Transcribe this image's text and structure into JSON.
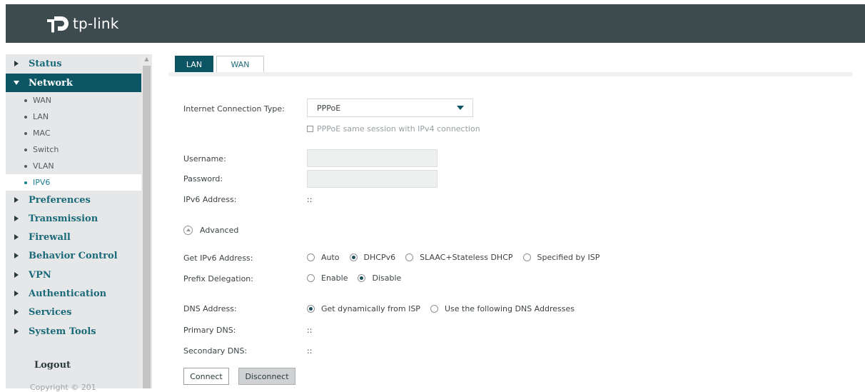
{
  "header": {
    "brand": "tp-link"
  },
  "sidebar": {
    "menu": [
      {
        "label": "Status"
      },
      {
        "label": "Network"
      },
      {
        "label": "Preferences"
      },
      {
        "label": "Transmission"
      },
      {
        "label": "Firewall"
      },
      {
        "label": "Behavior Control"
      },
      {
        "label": "VPN"
      },
      {
        "label": "Authentication"
      },
      {
        "label": "Services"
      },
      {
        "label": "System Tools"
      }
    ],
    "network_sub": [
      {
        "label": "WAN"
      },
      {
        "label": "LAN"
      },
      {
        "label": "MAC"
      },
      {
        "label": "Switch"
      },
      {
        "label": "VLAN"
      },
      {
        "label": "IPV6"
      }
    ],
    "logout": "Logout",
    "copyright": "Copyright © 201"
  },
  "tabs": {
    "lan": "LAN",
    "wan": "WAN"
  },
  "form": {
    "conn_type_label": "Internet Connection Type:",
    "conn_type_value": "PPPoE",
    "same_session_label": "PPPoE same session with IPv4 connection",
    "username_label": "Username:",
    "username_value": "",
    "password_label": "Password:",
    "password_value": "",
    "ipv6_address_label": "IPv6 Address:",
    "ipv6_address_value": "::",
    "advanced_label": "Advanced",
    "get_ipv6_label": "Get IPv6 Address:",
    "get_ipv6_options": [
      "Auto",
      "DHCPv6",
      "SLAAC+Stateless DHCP",
      "Specified by ISP"
    ],
    "get_ipv6_selected": "DHCPv6",
    "prefix_label": "Prefix Delegation:",
    "prefix_options": [
      "Enable",
      "Disable"
    ],
    "prefix_selected": "Disable",
    "dns_label": "DNS Address:",
    "dns_options": [
      "Get dynamically from ISP",
      "Use the following DNS Addresses"
    ],
    "dns_selected": "Get dynamically from ISP",
    "primary_dns_label": "Primary DNS:",
    "primary_dns_value": "::",
    "secondary_dns_label": "Secondary DNS:",
    "secondary_dns_value": "::",
    "connect_label": "Connect",
    "disconnect_label": "Disconnect"
  },
  "colors": {
    "header_bg": "#3d4a4e",
    "accent": "#0b5564",
    "sidebar_bg": "#e6e7e8"
  }
}
